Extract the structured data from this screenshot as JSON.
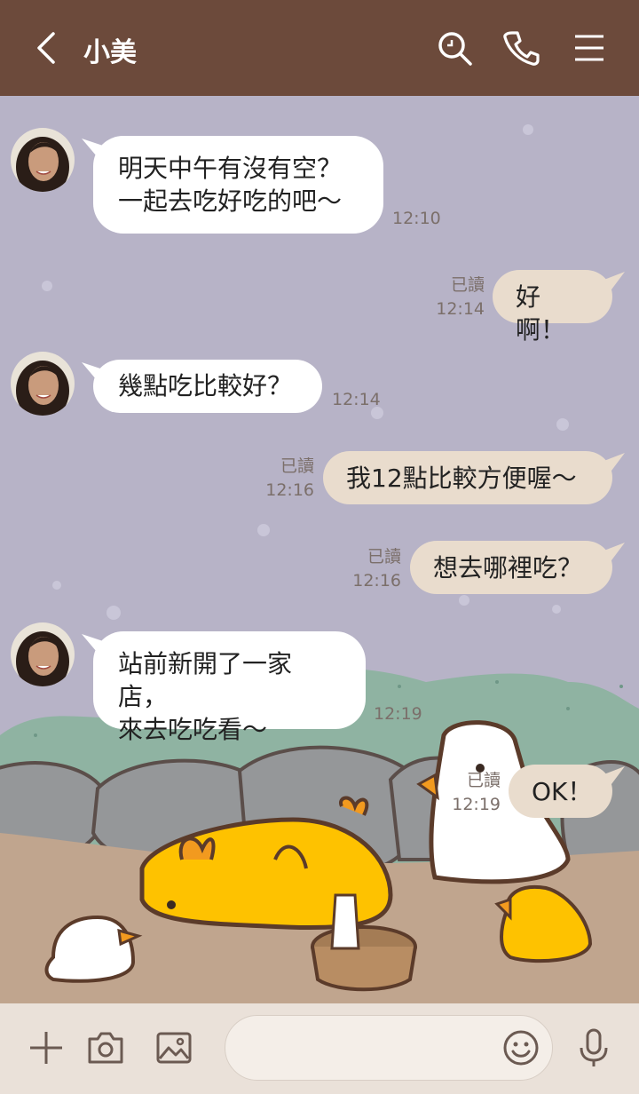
{
  "header": {
    "title": "小美"
  },
  "messages": [
    {
      "side": "left",
      "lines": [
        "明天中午有沒有空？",
        "一起去吃好吃的吧～"
      ],
      "time": "12:10"
    },
    {
      "side": "right",
      "lines": [
        "好啊！"
      ],
      "time": "12:14",
      "read": "已讀"
    },
    {
      "side": "left",
      "lines": [
        "幾點吃比較好？"
      ],
      "time": "12:14"
    },
    {
      "side": "right",
      "lines": [
        "我12點比較方便喔～"
      ],
      "time": "12:16",
      "read": "已讀"
    },
    {
      "side": "right",
      "lines": [
        "想去哪裡吃？"
      ],
      "time": "12:16",
      "read": "已讀"
    },
    {
      "side": "left",
      "lines": [
        "站前新開了一家店，",
        "來去吃吃看～"
      ],
      "time": "12:19"
    },
    {
      "side": "right",
      "lines": [
        "OK！"
      ],
      "time": "12:19",
      "read": "已讀"
    }
  ],
  "input": {
    "placeholder": ""
  },
  "colors": {
    "header": "#6c4a3b",
    "background": "#b7b3c7",
    "right_bubble": "#e9dccd",
    "footer": "#eae1d9"
  },
  "icons": [
    "back-icon",
    "search-icon",
    "phone-icon",
    "menu-icon",
    "plus-icon",
    "camera-icon",
    "image-icon",
    "emoji-icon",
    "microphone-icon"
  ]
}
